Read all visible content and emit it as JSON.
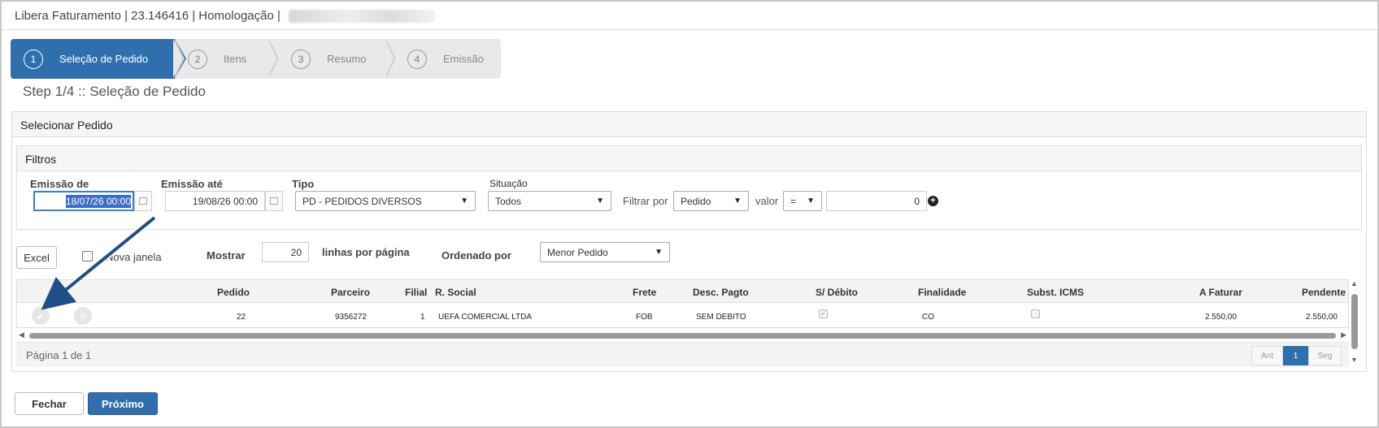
{
  "window": {
    "title": "Libera Faturamento | 23.146416 | Homologação |"
  },
  "wizard": {
    "steps": [
      {
        "num": "1",
        "label": "Seleção de Pedido"
      },
      {
        "num": "2",
        "label": "Itens"
      },
      {
        "num": "3",
        "label": "Resumo"
      },
      {
        "num": "4",
        "label": "Emissão"
      }
    ],
    "active_step": 1,
    "step_title": "Step 1/4 :: Seleção de Pedido"
  },
  "panel": {
    "title": "Selecionar Pedido"
  },
  "filters": {
    "title": "Filtros",
    "emissao_de_label": "Emissão de",
    "emissao_de_value": "18/07/26 00:00",
    "emissao_ate_label": "Emissão até",
    "emissao_ate_value": "19/08/26 00:00",
    "tipo_label": "Tipo",
    "tipo_value": "PD - PEDIDOS DIVERSOS",
    "situacao_label": "Situação",
    "situacao_value": "Todos",
    "filtrar_por_label": "Filtrar por",
    "filtrar_por_value": "Pedido",
    "valor_label": "valor",
    "operator_value": "=",
    "valor_value": "0"
  },
  "toolbar": {
    "excel_label": "Excel",
    "nova_janela_label": "Nova janela",
    "nova_janela_checked": false,
    "mostrar_label": "Mostrar",
    "mostrar_value": "20",
    "linhas_label": "linhas por página",
    "ordenado_label": "Ordenado por",
    "ordenado_value": "Menor Pedido"
  },
  "table": {
    "columns": [
      "Pedido",
      "Parceiro",
      "Filial",
      "R. Social",
      "Frete",
      "Desc. Pagto",
      "S/ Débito",
      "Finalidade",
      "Subst. ICMS",
      "A Faturar",
      "Pendente"
    ],
    "rows": [
      {
        "pedido": "22",
        "parceiro": "9356272",
        "filial": "1",
        "r_social": "UEFA COMERCIAL LTDA",
        "frete": "FOB",
        "desc_pagto": "SEM DEBITO",
        "s_debito": true,
        "finalidade": "CO",
        "subst_icms": false,
        "a_faturar": "2.550,00",
        "pendente": "2.550,00"
      }
    ]
  },
  "pager": {
    "text": "Página 1 de 1",
    "prev_label": "Ant",
    "current_page": "1",
    "next_label": "Seg"
  },
  "footer": {
    "fechar_label": "Fechar",
    "proximo_label": "Próximo"
  },
  "colors": {
    "accent": "#2f6fae",
    "arrow": "#1f4f86"
  }
}
